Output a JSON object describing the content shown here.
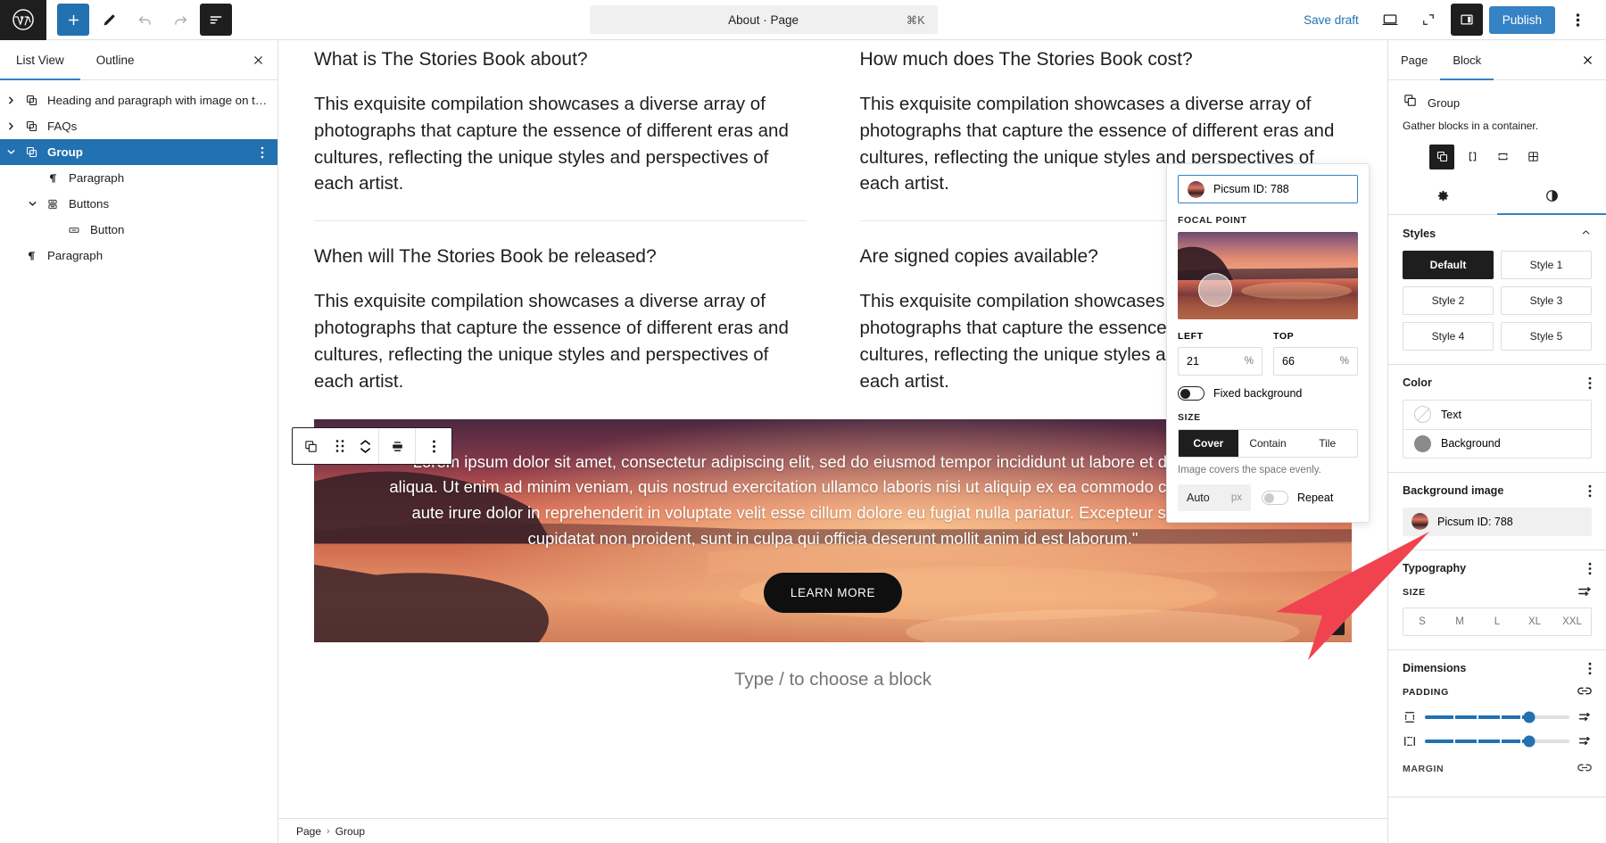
{
  "topbar": {
    "logo_icon": "wordpress-logo-icon",
    "tools": [
      {
        "name": "block-inserter",
        "icon": "plus-icon",
        "state": "primary"
      },
      {
        "name": "tools-edit",
        "icon": "pencil-icon",
        "state": "default"
      },
      {
        "name": "undo",
        "icon": "undo-arrow-icon",
        "state": "muted"
      },
      {
        "name": "redo",
        "icon": "redo-arrow-icon",
        "state": "muted"
      },
      {
        "name": "document-list-view",
        "icon": "list-view-icon",
        "state": "dark"
      }
    ],
    "document_title": "About · Page",
    "command_shortcut": "⌘K",
    "save_draft_label": "Save draft",
    "preview_icon": "desktop-icon",
    "fullscreen_icon": "expand-icon",
    "settings_icon": "sidebar-panel-icon",
    "publish_label": "Publish",
    "more_icon": "kebab-vertical-icon",
    "accent_blue": "#3582c4",
    "link_blue": "#2271b1"
  },
  "list_view": {
    "tabs": [
      {
        "label": "List View",
        "active": true
      },
      {
        "label": "Outline",
        "active": false
      }
    ],
    "close_icon": "close-icon",
    "items": [
      {
        "label": "Heading and paragraph with image on t…",
        "icon": "group-block-icon",
        "indent": 0,
        "chevron": "collapsed",
        "selected": false,
        "kebab": false
      },
      {
        "label": "FAQs",
        "icon": "group-block-icon",
        "indent": 0,
        "chevron": "collapsed",
        "selected": false,
        "kebab": false
      },
      {
        "label": "Group",
        "icon": "group-block-icon",
        "indent": 0,
        "chevron": "expanded",
        "selected": true,
        "kebab": true
      },
      {
        "label": "Paragraph",
        "icon": "paragraph-block-icon",
        "indent": 1,
        "chevron": "none",
        "selected": false,
        "kebab": false
      },
      {
        "label": "Buttons",
        "icon": "buttons-block-icon",
        "indent": 1,
        "chevron": "expanded",
        "selected": false,
        "kebab": false
      },
      {
        "label": "Button",
        "icon": "button-block-icon",
        "indent": 2,
        "chevron": "none",
        "selected": false,
        "kebab": false
      },
      {
        "label": "Paragraph",
        "icon": "paragraph-block-icon",
        "indent": 0,
        "chevron": "none",
        "selected": false,
        "kebab": false
      }
    ]
  },
  "canvas": {
    "faqs": [
      {
        "heading": "What is The Stories Book about?",
        "body": "This exquisite compilation showcases a diverse array of photographs that capture the essence of different eras and cultures, reflecting the unique styles and perspectives of each artist."
      },
      {
        "heading": "How much does The Stories Book cost?",
        "body": "This exquisite compilation showcases a diverse array of photographs that capture the essence of different eras and cultures, reflecting the unique styles and perspectives of each artist."
      },
      {
        "heading": "When will The Stories Book be released?",
        "body": "This exquisite compilation showcases a diverse array of photographs that capture the essence of different eras and cultures, reflecting the unique styles and perspectives of each artist."
      },
      {
        "heading": "Are signed copies available?",
        "body": "This exquisite compilation showcases a diverse array of photographs that capture the essence of different eras and cultures, reflecting the unique styles and perspectives of each artist."
      }
    ],
    "block_toolbar": [
      {
        "name": "block-type-group",
        "icon": "group-block-icon"
      },
      {
        "name": "drag-handle",
        "icon": "drag-dots-icon"
      },
      {
        "name": "move-up-down",
        "icon": "chevron-up-down-icon"
      },
      {
        "name": "align",
        "icon": "align-center-icon"
      },
      {
        "name": "block-options",
        "icon": "kebab-vertical-icon"
      }
    ],
    "cover": {
      "quote": "\"Lorem ipsum dolor sit amet, consectetur adipiscing elit, sed do eiusmod tempor incididunt ut labore et dolore magna aliqua. Ut enim ad minim veniam, quis nostrud exercitation ullamco laboris nisi ut aliquip ex ea commodo consequat. Duis aute irure dolor in reprehenderit in voluptate velit esse cillum dolore eu fugiat nulla pariatur. Excepteur sint occaecat cupidatat non proident, sunt in culpa qui officia deserunt mollit anim id est laborum.\"",
      "button_label": "LEARN MORE",
      "appender_icon": "plus-icon"
    },
    "placeholder": "Type / to choose a block",
    "breadcrumb": [
      "Page",
      "Group"
    ]
  },
  "popover": {
    "media_label": "Picsum ID: 788",
    "media_icon": "image-thumbnail-icon",
    "focal_point_label": "FOCAL POINT",
    "left_label": "LEFT",
    "left_value": "21",
    "left_unit": "%",
    "top_label": "TOP",
    "top_value": "66",
    "top_unit": "%",
    "fixed_background_label": "Fixed background",
    "fixed_background_on": true,
    "size_label": "SIZE",
    "size_options": [
      {
        "label": "Cover",
        "active": true
      },
      {
        "label": "Contain",
        "active": false
      },
      {
        "label": "Tile",
        "active": false
      }
    ],
    "size_hint": "Image covers the space evenly.",
    "auto_value": "Auto",
    "auto_unit": "px",
    "repeat_label": "Repeat",
    "repeat_on": false
  },
  "inspector": {
    "tabs": [
      {
        "label": "Page",
        "active": false
      },
      {
        "label": "Block",
        "active": true
      }
    ],
    "close_icon": "close-icon",
    "block": {
      "icon": "group-block-icon",
      "title": "Group",
      "description": "Gather blocks in a container.",
      "variations": [
        {
          "name": "group-variation-group",
          "icon": "group-block-icon",
          "active": true
        },
        {
          "name": "group-variation-row",
          "icon": "row-icon",
          "active": false
        },
        {
          "name": "group-variation-stack",
          "icon": "stack-icon",
          "active": false
        },
        {
          "name": "group-variation-grid",
          "icon": "grid-icon",
          "active": false
        }
      ]
    },
    "icon_tabs": [
      {
        "name": "settings-tab",
        "icon": "gear-icon",
        "active": false
      },
      {
        "name": "styles-tab",
        "icon": "contrast-half-circle-icon",
        "active": true
      }
    ],
    "styles": {
      "title": "Styles",
      "collapse_icon": "chevron-up-icon",
      "options": [
        {
          "label": "Default",
          "active": true
        },
        {
          "label": "Style 1",
          "active": false
        },
        {
          "label": "Style 2",
          "active": false
        },
        {
          "label": "Style 3",
          "active": false
        },
        {
          "label": "Style 4",
          "active": false
        },
        {
          "label": "Style 5",
          "active": false
        }
      ]
    },
    "color": {
      "title": "Color",
      "options_icon": "kebab-vertical-icon",
      "rows": [
        {
          "label": "Text",
          "swatch": "none"
        },
        {
          "label": "Background",
          "swatch": "#8a8a8a"
        }
      ]
    },
    "background_image": {
      "title": "Background image",
      "options_icon": "kebab-vertical-icon",
      "value": "Picsum ID: 788"
    },
    "typography": {
      "title": "Typography",
      "options_icon": "kebab-vertical-icon",
      "size_label": "SIZE",
      "size_tools_icon": "sliders-icon",
      "sizes": [
        "S",
        "M",
        "L",
        "XL",
        "XXL"
      ]
    },
    "dimensions": {
      "title": "Dimensions",
      "options_icon": "kebab-vertical-icon",
      "padding_label": "PADDING",
      "link_icon": "link-sides-icon",
      "sliders": [
        {
          "name": "padding-vertical",
          "icon": "vertical-sides-icon",
          "percent": 72
        },
        {
          "name": "padding-horizontal",
          "icon": "horizontal-sides-icon",
          "percent": 72
        }
      ],
      "margin_label": "MARGIN"
    }
  }
}
